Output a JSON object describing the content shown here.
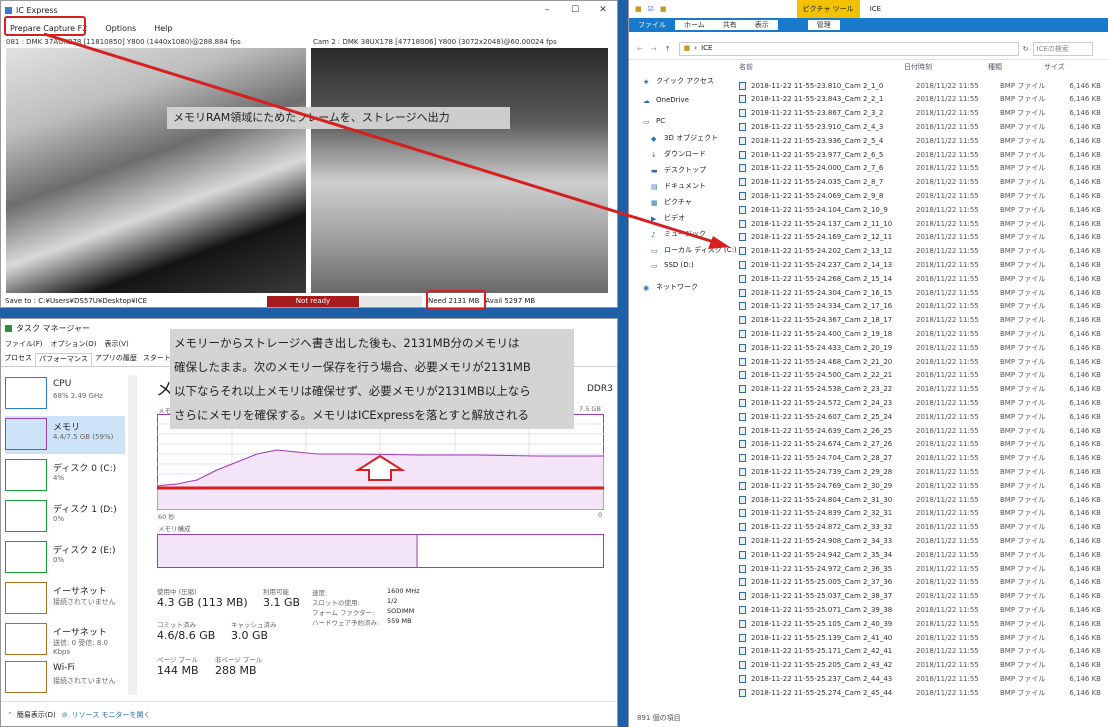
{
  "ice": {
    "title": "IC Express",
    "menu": [
      "Prepare Capture F2",
      "Options",
      "Help"
    ],
    "cam1_label": "081 : DMK 37AUX278 [11810850] Y800 (1440x1080)@288.884 fps",
    "cam2_label": "Cam 2 : DMK 38UX178 [47718006] Y800 (3072x2048)@60.00024 fps",
    "save_to": "Save to : C:¥Users¥DS57U¥Desktop¥ICE",
    "status": "Not ready",
    "need": "Need 2131 MB",
    "avail": "Avail 5297 MB"
  },
  "annotations": {
    "top": "メモリRAM領域にためたフレームを、ストレージへ出力",
    "bottom": [
      "メモリーからストレージへ書き出した後も、2131MB分のメモリは",
      "確保したまま。次のメモリー保存を行う場合、必要メモリが2131MB",
      "以下ならそれ以上メモリは確保せず、必要メモリが2131MB以上なら",
      "さらにメモリを確保する。メモリはICExpressを落とすと解放される"
    ]
  },
  "explorer": {
    "title": "ICE",
    "ribbon_context": "ピクチャ ツール",
    "ribbon_tabs": [
      "ファイル",
      "ホーム",
      "共有",
      "表示"
    ],
    "ribbon_context_tab": "管理",
    "address": "ICE",
    "search_placeholder": "ICEの検索",
    "columns": {
      "name": "名前",
      "date": "日付時刻",
      "type": "種類",
      "size": "サイズ"
    },
    "nav": [
      {
        "label": "クイック アクセス",
        "icon": "star-icon"
      },
      {
        "label": "OneDrive",
        "icon": "cloud-icon"
      },
      {
        "label": "PC",
        "icon": "pc-icon"
      },
      {
        "label": "3D オブジェクト",
        "icon": "cube-icon"
      },
      {
        "label": "ダウンロード",
        "icon": "download-icon"
      },
      {
        "label": "デスクトップ",
        "icon": "desktop-icon"
      },
      {
        "label": "ドキュメント",
        "icon": "document-icon"
      },
      {
        "label": "ピクチャ",
        "icon": "picture-icon"
      },
      {
        "label": "ビデオ",
        "icon": "video-icon"
      },
      {
        "label": "ミュージック",
        "icon": "music-icon"
      },
      {
        "label": "ローカル ディスク (C:)",
        "icon": "disk-icon"
      },
      {
        "label": "SSD (D:)",
        "icon": "disk-icon"
      },
      {
        "label": "ネットワーク",
        "icon": "network-icon"
      }
    ],
    "date": "2018/11/22 11:55",
    "type": "BMP ファイル",
    "size": "6,146 KB",
    "files": [
      "2018-11-22 11-55-23.810_Cam 2_1_0",
      "2018-11-22 11-55-23.843_Cam 2_2_1",
      "2018-11-22 11-55-23.867_Cam 2_3_2",
      "2018-11-22 11-55-23.910_Cam 2_4_3",
      "2018-11-22 11-55-23.936_Cam 2_5_4",
      "2018-11-22 11-55-23.977_Cam 2_6_5",
      "2018-11-22 11-55-24.000_Cam 2_7_6",
      "2018-11-22 11-55-24.035_Cam 2_8_7",
      "2018-11-22 11-55-24.069_Cam 2_9_8",
      "2018-11-22 11-55-24.104_Cam 2_10_9",
      "2018-11-22 11-55-24.137_Cam 2_11_10",
      "2018-11-22 11-55-24.169_Cam 2_12_11",
      "2018-11-22 11-55-24.202_Cam 2_13_12",
      "2018-11-22 11-55-24.237_Cam 2_14_13",
      "2018-11-22 11-55-24.268_Cam 2_15_14",
      "2018-11-22 11-55-24.304_Cam 2_16_15",
      "2018-11-22 11-55-24.334_Cam 2_17_16",
      "2018-11-22 11-55-24.367_Cam 2_18_17",
      "2018-11-22 11-55-24.400_Cam 2_19_18",
      "2018-11-22 11-55-24.433_Cam 2_20_19",
      "2018-11-22 11-55-24.468_Cam 2_21_20",
      "2018-11-22 11-55-24.500_Cam 2_22_21",
      "2018-11-22 11-55-24.538_Cam 2_23_22",
      "2018-11-22 11-55-24.572_Cam 2_24_23",
      "2018-11-22 11-55-24.607_Cam 2_25_24",
      "2018-11-22 11-55-24.639_Cam 2_26_25",
      "2018-11-22 11-55-24.674_Cam 2_27_26",
      "2018-11-22 11-55-24.704_Cam 2_28_27",
      "2018-11-22 11-55-24.739_Cam 2_29_28",
      "2018-11-22 11-55-24.769_Cam 2_30_29",
      "2018-11-22 11-55-24.804_Cam 2_31_30",
      "2018-11-22 11-55-24.839_Cam 2_32_31",
      "2018-11-22 11-55-24.872_Cam 2_33_32",
      "2018-11-22 11-55-24.908_Cam 2_34_33",
      "2018-11-22 11-55-24.942_Cam 2_35_34",
      "2018-11-22 11-55-24.972_Cam 2_36_35",
      "2018-11-22 11-55-25.005_Cam 2_37_36",
      "2018-11-22 11-55-25.037_Cam 2_38_37",
      "2018-11-22 11-55-25.071_Cam 2_39_38",
      "2018-11-22 11-55-25.105_Cam 2_40_39",
      "2018-11-22 11-55-25.139_Cam 2_41_40",
      "2018-11-22 11-55-25.171_Cam 2_42_41",
      "2018-11-22 11-55-25.205_Cam 2_43_42",
      "2018-11-22 11-55-25.237_Cam 2_44_43",
      "2018-11-22 11-55-25.274_Cam 2_45_44"
    ],
    "item_count": "891 個の項目"
  },
  "taskmgr": {
    "title": "タスク マネージャー",
    "menu": [
      "ファイル(F)",
      "オプション(O)",
      "表示(V)"
    ],
    "tabs": [
      "プロセス",
      "パフォーマンス",
      "アプリの履歴",
      "スタートアップ"
    ],
    "sidebar": [
      {
        "name": "CPU",
        "detail": "68% 2.49 GHz"
      },
      {
        "name": "メモリ",
        "detail": "4.4/7.5 GB (59%)"
      },
      {
        "name": "ディスク 0 (C:)",
        "detail": "4%"
      },
      {
        "name": "ディスク 1 (D:)",
        "detail": "0%"
      },
      {
        "name": "ディスク 2 (E:)",
        "detail": "0%"
      },
      {
        "name": "イーサネット",
        "detail": "接続されていません"
      },
      {
        "name": "イーサネット",
        "detail": "送信: 0 受信: 8.0 Kbps"
      },
      {
        "name": "Wi-Fi",
        "detail": "接続されていません"
      }
    ],
    "heading": "メ",
    "mem_type": "DDR3",
    "usage_label": "メモリ使用量",
    "max": "7.5 GB",
    "x_left": "60 秒",
    "x_right": "0",
    "composition_label": "メモリ構成",
    "stats": {
      "in_use_label": "使用中 (圧縮)",
      "in_use": "4.3 GB (113 MB)",
      "available_label": "利用可能",
      "available": "3.1 GB",
      "committed_label": "コミット済み",
      "committed": "4.6/8.6 GB",
      "cached_label": "キャッシュ済み",
      "cached": "3.0 GB",
      "paged_label": "ページ プール",
      "paged": "144 MB",
      "nonpaged_label": "非ページ プール",
      "nonpaged": "288 MB"
    },
    "specs": [
      [
        "速度:",
        "1600 MHz"
      ],
      [
        "スロットの使用:",
        "1/2"
      ],
      [
        "フォーム ファクター:",
        "SODIMM"
      ],
      [
        "ハードウェア予約済み:",
        "559 MB"
      ]
    ],
    "footer_less": "簡易表示(D)",
    "footer_monitor": "リソース モニターを開く"
  },
  "colors": {
    "accent": "#d62020",
    "chart": "#9b3db5",
    "ribbon": "#1979ca"
  }
}
